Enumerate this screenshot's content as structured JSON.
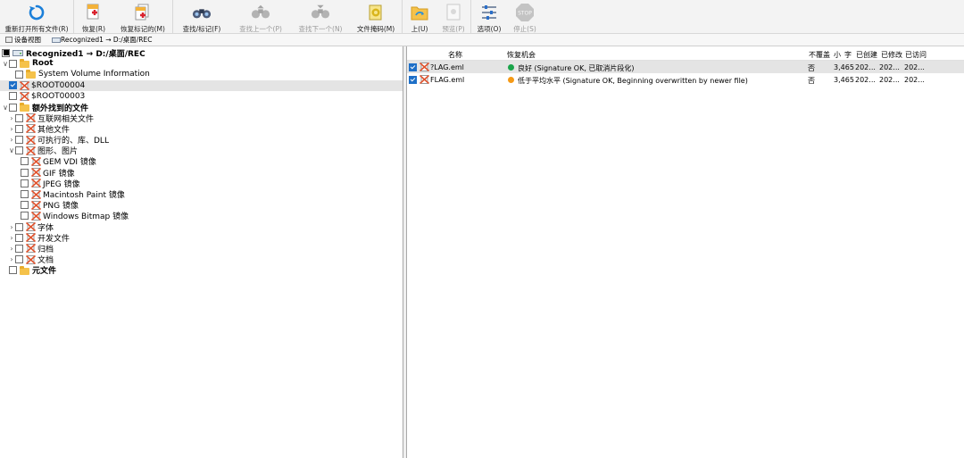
{
  "toolbar": {
    "buttons": [
      {
        "label": "重新打开所有文件(R)",
        "icon": "refresh-icon",
        "disabled": false
      },
      {
        "label": "恢复(R)",
        "icon": "recover-icon",
        "disabled": false
      },
      {
        "label": "恢复标记的(M)",
        "icon": "recover-marked-icon",
        "disabled": false
      },
      {
        "label": "查找/标记(F)",
        "icon": "binoculars-icon",
        "disabled": false
      },
      {
        "label": "查找上一个(P)",
        "icon": "find-prev-icon",
        "disabled": true
      },
      {
        "label": "查找下一个(N)",
        "icon": "find-next-icon",
        "disabled": true
      },
      {
        "label": "文件掩码(M)",
        "icon": "file-mask-icon",
        "disabled": false
      },
      {
        "label": "上(U)",
        "icon": "folder-up-icon",
        "disabled": false
      },
      {
        "label": "预览(P)",
        "icon": "preview-icon",
        "disabled": true
      },
      {
        "label": "选项(O)",
        "icon": "options-icon",
        "disabled": false
      },
      {
        "label": "停止(S)",
        "icon": "stop-icon",
        "disabled": true
      }
    ],
    "stop_text": "STOP"
  },
  "tabs": [
    {
      "label": "设备视图"
    },
    {
      "label": "Recognized1 → D:/桌面/REC"
    }
  ],
  "tree": {
    "items": [
      {
        "label": "Recognized1 → D:/桌面/REC",
        "level": 0,
        "expander": "",
        "check": "partial",
        "icon": "drive-icon",
        "bold": true
      },
      {
        "label": "Root",
        "level": 0,
        "expander": "v",
        "check": "none",
        "icon": "folder-icon",
        "bold": true
      },
      {
        "label": "System Volume Information",
        "level": 1,
        "expander": "",
        "check": "none",
        "icon": "folder-icon",
        "bold": false
      },
      {
        "label": "$ROOT00004",
        "level": 0,
        "expander": "",
        "check": "checked",
        "icon": "deleted-file-icon",
        "bold": false,
        "selected": true
      },
      {
        "label": "$ROOT00003",
        "level": 0,
        "expander": "",
        "check": "none",
        "icon": "deleted-file-icon",
        "bold": false
      },
      {
        "label": "额外找到的文件",
        "level": 0,
        "expander": "v",
        "check": "none",
        "icon": "folder-icon",
        "bold": true
      },
      {
        "label": "互联网相关文件",
        "level": 1,
        "expander": ">",
        "check": "none",
        "icon": "deleted-file-icon",
        "bold": false
      },
      {
        "label": "其他文件",
        "level": 1,
        "expander": ">",
        "check": "none",
        "icon": "deleted-file-icon",
        "bold": false
      },
      {
        "label": "可执行的、库、DLL",
        "level": 1,
        "expander": ">",
        "check": "none",
        "icon": "deleted-file-icon",
        "bold": false
      },
      {
        "label": "图形、图片",
        "level": 1,
        "expander": "v",
        "check": "none",
        "icon": "deleted-file-icon",
        "bold": false
      },
      {
        "label": "GEM VDI 镜像",
        "level": 2,
        "expander": "",
        "check": "none",
        "icon": "deleted-file-icon",
        "bold": false
      },
      {
        "label": "GIF 镜像",
        "level": 2,
        "expander": "",
        "check": "none",
        "icon": "deleted-file-icon",
        "bold": false
      },
      {
        "label": "JPEG 镜像",
        "level": 2,
        "expander": "",
        "check": "none",
        "icon": "deleted-file-icon",
        "bold": false
      },
      {
        "label": "Macintosh Paint 镜像",
        "level": 2,
        "expander": "",
        "check": "none",
        "icon": "deleted-file-icon",
        "bold": false
      },
      {
        "label": "PNG 镜像",
        "level": 2,
        "expander": "",
        "check": "none",
        "icon": "deleted-file-icon",
        "bold": false
      },
      {
        "label": "Windows Bitmap 镜像",
        "level": 2,
        "expander": "",
        "check": "none",
        "icon": "deleted-file-icon",
        "bold": false
      },
      {
        "label": "字体",
        "level": 1,
        "expander": ">",
        "check": "none",
        "icon": "deleted-file-icon",
        "bold": false
      },
      {
        "label": "开发文件",
        "level": 1,
        "expander": ">",
        "check": "none",
        "icon": "deleted-file-icon",
        "bold": false
      },
      {
        "label": "归档",
        "level": 1,
        "expander": ">",
        "check": "none",
        "icon": "deleted-file-icon",
        "bold": false
      },
      {
        "label": "文档",
        "level": 1,
        "expander": ">",
        "check": "none",
        "icon": "deleted-file-icon",
        "bold": false
      },
      {
        "label": "元文件",
        "level": 0,
        "expander": "",
        "check": "none",
        "icon": "folder-icon",
        "bold": true
      }
    ]
  },
  "list": {
    "columns": [
      "名称",
      "恢复机会",
      "不覆盖",
      "小",
      "字",
      "已创建",
      "已修改",
      "已访问"
    ],
    "rows": [
      {
        "checked": true,
        "name": "?LAG.eml",
        "status_color": "#1aa44a",
        "chance": "良好 (Signature OK, 已取消片段化)",
        "overwritten": "否",
        "size": "3,465",
        "created": "202...",
        "modified": "202...",
        "accessed": "202...",
        "selected": true
      },
      {
        "checked": true,
        "name": "FLAG.eml",
        "status_color": "#f59a16",
        "chance": "低于平均水平 (Signature OK, Beginning overwritten by newer file)",
        "overwritten": "否",
        "size": "3,465",
        "created": "202...",
        "modified": "202...",
        "accessed": "202...",
        "selected": false
      }
    ]
  }
}
